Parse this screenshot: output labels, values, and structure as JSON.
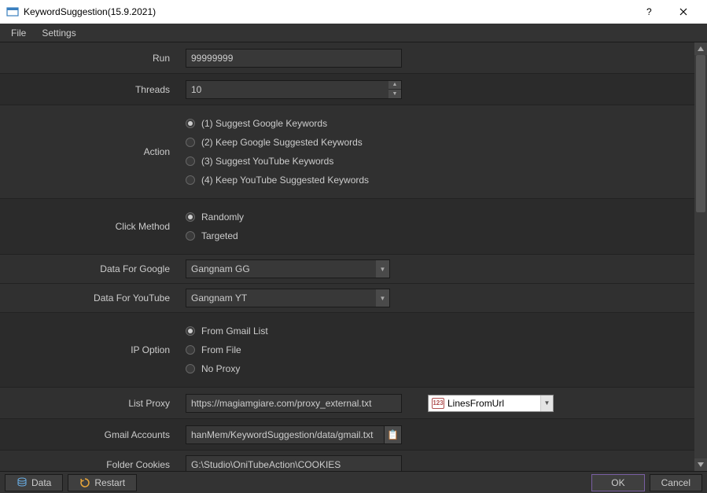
{
  "window": {
    "title": "KeywordSuggestion(15.9.2021)"
  },
  "menu": {
    "file": "File",
    "settings": "Settings"
  },
  "form": {
    "run": {
      "label": "Run",
      "value": "99999999"
    },
    "threads": {
      "label": "Threads",
      "value": "10"
    },
    "action": {
      "label": "Action",
      "options": [
        "(1) Suggest Google Keywords",
        "(2) Keep Google Suggested Keywords",
        "(3) Suggest YouTube Keywords",
        "(4) Keep YouTube Suggested Keywords"
      ],
      "selected": 0
    },
    "click_method": {
      "label": "Click Method",
      "options": [
        "Randomly",
        "Targeted"
      ],
      "selected": 0
    },
    "data_google": {
      "label": "Data For Google",
      "value": "Gangnam GG"
    },
    "data_youtube": {
      "label": "Data For YouTube",
      "value": "Gangnam YT"
    },
    "ip_option": {
      "label": "IP Option",
      "options": [
        "From Gmail List",
        "From File",
        "No Proxy"
      ],
      "selected": 0
    },
    "list_proxy": {
      "label": "List Proxy",
      "value": "https://magiamgiare.com/proxy_external.txt",
      "source_type": "LinesFromUrl",
      "source_icon_text": "123"
    },
    "gmail_accounts": {
      "label": "Gmail Accounts",
      "value": "hanMem/KeywordSuggestion/data/gmail.txt"
    },
    "folder_cookies": {
      "label": "Folder Cookies",
      "value": "G:\\Studio\\OniTubeAction\\COOKIES"
    }
  },
  "bottombar": {
    "data_btn": "Data",
    "restart_btn": "Restart",
    "ok_btn": "OK",
    "cancel_btn": "Cancel"
  }
}
